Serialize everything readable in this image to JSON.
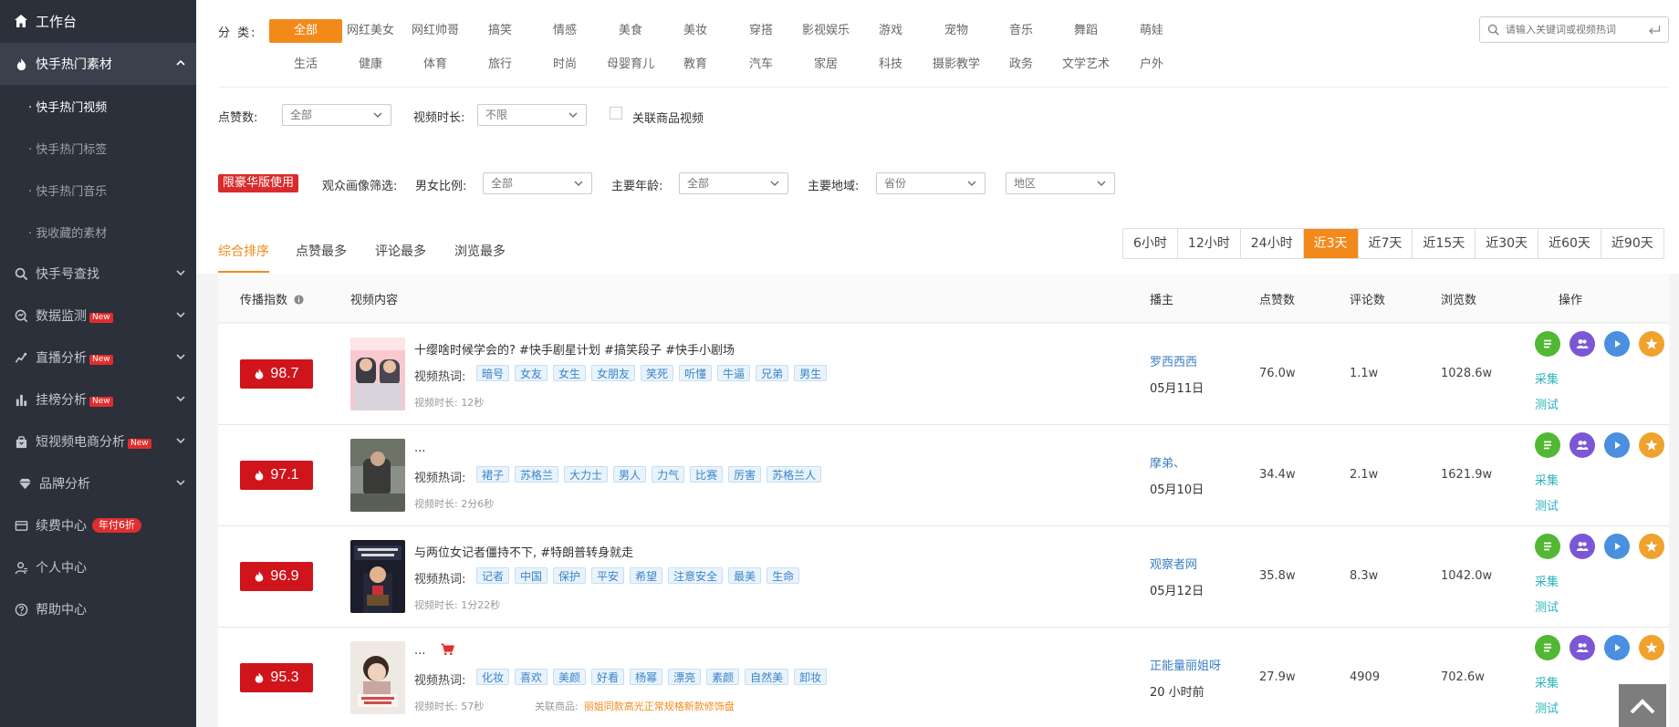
{
  "sidebar": {
    "workbench": "工作台",
    "kuaishou_hot": "快手热门素材",
    "sub": [
      "· 快手热门视频",
      "· 快手热门标签",
      "· 快手热门音乐",
      "· 我收藏的素材"
    ],
    "items": [
      {
        "label": "快手号查找",
        "badge": ""
      },
      {
        "label": "数据监测",
        "badge": "New"
      },
      {
        "label": "直播分析",
        "badge": "New"
      },
      {
        "label": "挂榜分析",
        "badge": "New"
      },
      {
        "label": "短视频电商分析",
        "badge": "New"
      },
      {
        "label": "品牌分析",
        "badge": ""
      },
      {
        "label": "续费中心",
        "badge": "年付6折"
      },
      {
        "label": "个人中心",
        "badge": ""
      },
      {
        "label": "帮助中心",
        "badge": ""
      }
    ]
  },
  "filters": {
    "category_label": "分 类:",
    "categories_row1": [
      "全部",
      "网红美女",
      "网红帅哥",
      "搞笑",
      "情感",
      "美食",
      "美妆",
      "穿搭",
      "影视娱乐",
      "游戏",
      "宠物",
      "音乐",
      "舞蹈",
      "萌娃"
    ],
    "categories_row2": [
      "生活",
      "健康",
      "体育",
      "旅行",
      "时尚",
      "母婴育儿",
      "教育",
      "汽车",
      "家居",
      "科技",
      "摄影教学",
      "政务",
      "文学艺术",
      "户外"
    ],
    "search_placeholder": "请输入关键词或视频热词",
    "likes_label": "点赞数:",
    "likes_value": "全部",
    "duration_label": "视频时长:",
    "duration_value": "不限",
    "linked_goods": "关联商品视频",
    "vip_tag": "限豪华版使用",
    "audience_label": "观众画像筛选:",
    "gender_label": "男女比例:",
    "gender_value": "全部",
    "age_label": "主要年龄:",
    "age_value": "全部",
    "region_label": "主要地域:",
    "province_value": "省份",
    "area_value": "地区"
  },
  "sort_tabs": [
    "综合排序",
    "点赞最多",
    "评论最多",
    "浏览最多"
  ],
  "time_ranges": [
    "6小时",
    "12小时",
    "24小时",
    "近3天",
    "近7天",
    "近15天",
    "近30天",
    "近60天",
    "近90天"
  ],
  "active_time": "近3天",
  "table": {
    "headers": [
      "传播指数",
      "视频内容",
      "播主",
      "点赞数",
      "评论数",
      "浏览数",
      "操作"
    ],
    "kw_label": "视频热词:",
    "duration_prefix": "视频时长:",
    "collect": "采集",
    "test": "测试",
    "rows": [
      {
        "score": "98.7",
        "title": "十缨啥时候学会的? #快手剧星计划 #搞笑段子 #快手小剧场",
        "keywords": [
          "暗号",
          "女友",
          "女生",
          "女朋友",
          "笑死",
          "听懂",
          "牛逼",
          "兄弟",
          "男生"
        ],
        "duration": "视频时长: 12秒",
        "author": "罗西西西",
        "date": "05月11日",
        "likes": "76.0w",
        "comments": "1.1w",
        "views": "1028.6w",
        "has_cart": false,
        "product": ""
      },
      {
        "score": "97.1",
        "title": "...",
        "keywords": [
          "裙子",
          "苏格兰",
          "大力士",
          "男人",
          "力气",
          "比赛",
          "厉害",
          "苏格兰人"
        ],
        "duration": "视频时长: 2分6秒",
        "author": "摩弟、",
        "date": "05月10日",
        "likes": "34.4w",
        "comments": "2.1w",
        "views": "1621.9w",
        "has_cart": false,
        "product": ""
      },
      {
        "score": "96.9",
        "title": "与两位女记者僵持不下, #特朗普转身就走",
        "keywords": [
          "记者",
          "中国",
          "保护",
          "平安",
          "希望",
          "注意安全",
          "最美",
          "生命"
        ],
        "duration": "视频时长: 1分22秒",
        "author": "观察者网",
        "date": "05月12日",
        "likes": "35.8w",
        "comments": "8.3w",
        "views": "1042.0w",
        "has_cart": false,
        "product": ""
      },
      {
        "score": "95.3",
        "title": "...",
        "keywords": [
          "化妆",
          "喜欢",
          "美颜",
          "好看",
          "杨幂",
          "漂亮",
          "素颜",
          "自然美",
          "卸妆"
        ],
        "duration": "视频时长: 57秒",
        "author": "正能量丽姐呀",
        "date": "20 小时前",
        "likes": "27.9w",
        "comments": "4909",
        "views": "702.6w",
        "has_cart": true,
        "product_label": "关联商品:",
        "product": "丽姐同款高光正常规格新款修饰盘"
      }
    ]
  },
  "colors": {
    "accent": "#f28a1b",
    "sidebar_bg": "#2b303b",
    "score_red": "#d0141c",
    "link_blue": "#3a7fc3",
    "op_green": "#52b833",
    "op_purple": "#7b57d6",
    "op_blue": "#4a8fe0",
    "op_orange": "#f0a22e"
  },
  "icons": [
    "home-icon",
    "fire-icon",
    "search-icon",
    "monitor-icon",
    "live-icon",
    "bar-chart-icon",
    "shop-bag-icon",
    "diamond-icon",
    "card-icon",
    "user-icon",
    "help-icon",
    "list-icon",
    "people-icon",
    "play-icon",
    "star-icon",
    "cart-icon",
    "back-to-top-icon"
  ]
}
